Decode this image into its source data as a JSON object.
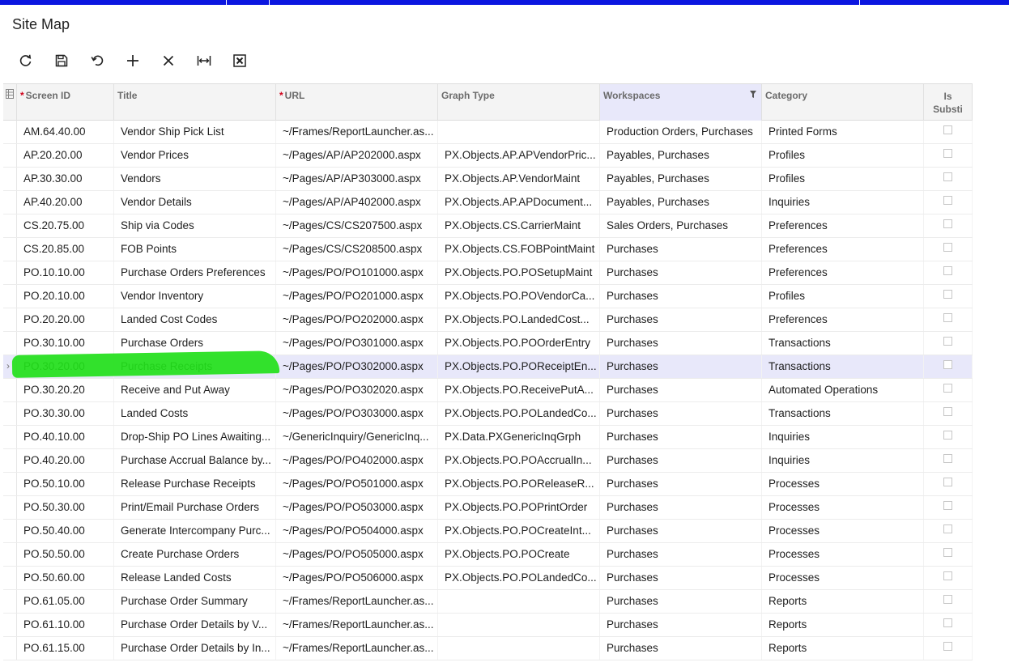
{
  "page": {
    "title": "Site Map"
  },
  "toolbar": {
    "buttons": [
      {
        "name": "refresh-button",
        "icon": "refresh-icon"
      },
      {
        "name": "save-button",
        "icon": "save-icon"
      },
      {
        "name": "undo-button",
        "icon": "undo-icon"
      },
      {
        "name": "add-row-button",
        "icon": "plus-icon"
      },
      {
        "name": "delete-row-button",
        "icon": "close-icon"
      },
      {
        "name": "fit-columns-button",
        "icon": "fit-width-icon"
      },
      {
        "name": "export-excel-button",
        "icon": "excel-icon"
      }
    ]
  },
  "grid": {
    "columns": {
      "screen_id": "Screen ID",
      "title": "Title",
      "url": "URL",
      "graph_type": "Graph Type",
      "workspaces": "Workspaces",
      "category": "Category",
      "is_substitute_line1": "Is",
      "is_substitute_line2": "Substi"
    },
    "selected_row": 10,
    "rows": [
      {
        "id": "AM.64.40.00",
        "title": "Vendor Ship Pick List",
        "url": "~/Frames/ReportLauncher.as...",
        "graph": "",
        "ws": "Production Orders, Purchases",
        "cat": "Printed Forms"
      },
      {
        "id": "AP.20.20.00",
        "title": "Vendor Prices",
        "url": "~/Pages/AP/AP202000.aspx",
        "graph": "PX.Objects.AP.APVendorPric...",
        "ws": "Payables, Purchases",
        "cat": "Profiles"
      },
      {
        "id": "AP.30.30.00",
        "title": "Vendors",
        "url": "~/Pages/AP/AP303000.aspx",
        "graph": "PX.Objects.AP.VendorMaint",
        "ws": "Payables, Purchases",
        "cat": "Profiles"
      },
      {
        "id": "AP.40.20.00",
        "title": "Vendor Details",
        "url": "~/Pages/AP/AP402000.aspx",
        "graph": "PX.Objects.AP.APDocument...",
        "ws": "Payables, Purchases",
        "cat": "Inquiries"
      },
      {
        "id": "CS.20.75.00",
        "title": "Ship via Codes",
        "url": "~/Pages/CS/CS207500.aspx",
        "graph": "PX.Objects.CS.CarrierMaint",
        "ws": "Sales Orders, Purchases",
        "cat": "Preferences"
      },
      {
        "id": "CS.20.85.00",
        "title": "FOB Points",
        "url": "~/Pages/CS/CS208500.aspx",
        "graph": "PX.Objects.CS.FOBPointMaint",
        "ws": "Purchases",
        "cat": "Preferences"
      },
      {
        "id": "PO.10.10.00",
        "title": "Purchase Orders Preferences",
        "url": "~/Pages/PO/PO101000.aspx",
        "graph": "PX.Objects.PO.POSetupMaint",
        "ws": "Purchases",
        "cat": "Preferences"
      },
      {
        "id": "PO.20.10.00",
        "title": "Vendor Inventory",
        "url": "~/Pages/PO/PO201000.aspx",
        "graph": "PX.Objects.PO.POVendorCa...",
        "ws": "Purchases",
        "cat": "Profiles"
      },
      {
        "id": "PO.20.20.00",
        "title": "Landed Cost Codes",
        "url": "~/Pages/PO/PO202000.aspx",
        "graph": "PX.Objects.PO.LandedCost...",
        "ws": "Purchases",
        "cat": "Preferences"
      },
      {
        "id": "PO.30.10.00",
        "title": "Purchase Orders",
        "url": "~/Pages/PO/PO301000.aspx",
        "graph": "PX.Objects.PO.POOrderEntry",
        "ws": "Purchases",
        "cat": "Transactions"
      },
      {
        "id": "PO.30.20.00",
        "title": "Purchase Receipts",
        "url": "~/Pages/PO/PO302000.aspx",
        "graph": "PX.Objects.PO.POReceiptEn...",
        "ws": "Purchases",
        "cat": "Transactions"
      },
      {
        "id": "PO.30.20.20",
        "title": "Receive and Put Away",
        "url": "~/Pages/PO/PO302020.aspx",
        "graph": "PX.Objects.PO.ReceivePutA...",
        "ws": "Purchases",
        "cat": "Automated Operations"
      },
      {
        "id": "PO.30.30.00",
        "title": "Landed Costs",
        "url": "~/Pages/PO/PO303000.aspx",
        "graph": "PX.Objects.PO.POLandedCo...",
        "ws": "Purchases",
        "cat": "Transactions"
      },
      {
        "id": "PO.40.10.00",
        "title": "Drop-Ship PO Lines Awaiting...",
        "url": "~/GenericInquiry/GenericInq...",
        "graph": "PX.Data.PXGenericInqGrph",
        "ws": "Purchases",
        "cat": "Inquiries"
      },
      {
        "id": "PO.40.20.00",
        "title": "Purchase Accrual Balance by...",
        "url": "~/Pages/PO/PO402000.aspx",
        "graph": "PX.Objects.PO.POAccrualIn...",
        "ws": "Purchases",
        "cat": "Inquiries"
      },
      {
        "id": "PO.50.10.00",
        "title": "Release Purchase Receipts",
        "url": "~/Pages/PO/PO501000.aspx",
        "graph": "PX.Objects.PO.POReleaseR...",
        "ws": "Purchases",
        "cat": "Processes"
      },
      {
        "id": "PO.50.30.00",
        "title": "Print/Email Purchase Orders",
        "url": "~/Pages/PO/PO503000.aspx",
        "graph": "PX.Objects.PO.POPrintOrder",
        "ws": "Purchases",
        "cat": "Processes"
      },
      {
        "id": "PO.50.40.00",
        "title": "Generate Intercompany Purc...",
        "url": "~/Pages/PO/PO504000.aspx",
        "graph": "PX.Objects.PO.POCreateInt...",
        "ws": "Purchases",
        "cat": "Processes"
      },
      {
        "id": "PO.50.50.00",
        "title": "Create Purchase Orders",
        "url": "~/Pages/PO/PO505000.aspx",
        "graph": "PX.Objects.PO.POCreate",
        "ws": "Purchases",
        "cat": "Processes"
      },
      {
        "id": "PO.50.60.00",
        "title": "Release Landed Costs",
        "url": "~/Pages/PO/PO506000.aspx",
        "graph": "PX.Objects.PO.POLandedCo...",
        "ws": "Purchases",
        "cat": "Processes"
      },
      {
        "id": "PO.61.05.00",
        "title": "Purchase Order Summary",
        "url": "~/Frames/ReportLauncher.as...",
        "graph": "",
        "ws": "Purchases",
        "cat": "Reports"
      },
      {
        "id": "PO.61.10.00",
        "title": "Purchase Order Details by V...",
        "url": "~/Frames/ReportLauncher.as...",
        "graph": "",
        "ws": "Purchases",
        "cat": "Reports"
      },
      {
        "id": "PO.61.15.00",
        "title": "Purchase Order Details by In...",
        "url": "~/Frames/ReportLauncher.as...",
        "graph": "",
        "ws": "Purchases",
        "cat": "Reports"
      }
    ]
  }
}
